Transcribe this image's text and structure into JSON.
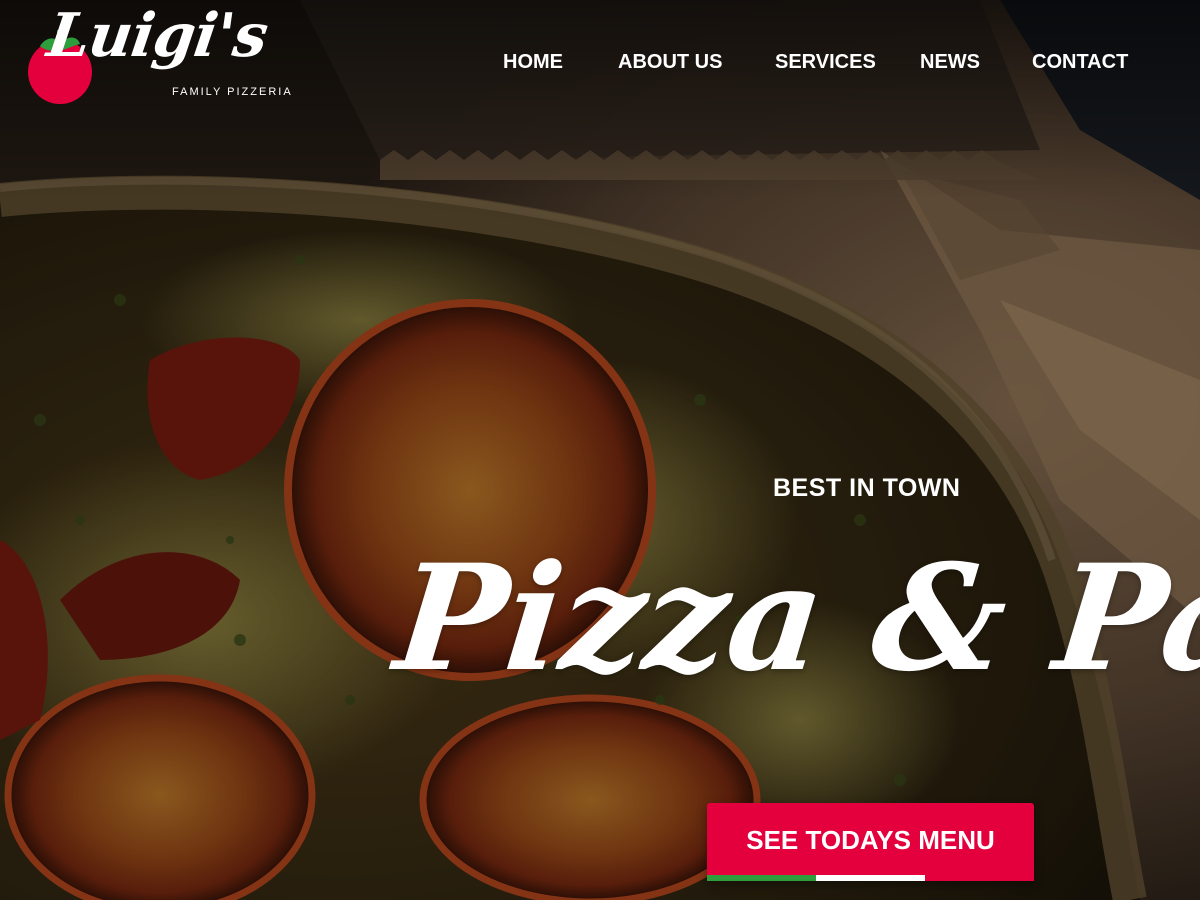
{
  "brand": {
    "name": "Luigi's",
    "tagline": "FAMILY PIZZERIA",
    "icon": "tomato-icon"
  },
  "nav": {
    "items": [
      {
        "label": "HOME"
      },
      {
        "label": "ABOUT US"
      },
      {
        "label": "SERVICES"
      },
      {
        "label": "NEWS"
      },
      {
        "label": "CONTACT"
      }
    ]
  },
  "hero": {
    "eyebrow": "BEST IN TOWN",
    "headline": "Pizza & Pasta",
    "cta_label": "SEE TODAYS MENU",
    "background": "pizza-photo"
  },
  "colors": {
    "accent": "#e4003c",
    "stripe_green": "#2e9e3c",
    "stripe_white": "#ffffff",
    "stripe_red": "#e4003c"
  }
}
